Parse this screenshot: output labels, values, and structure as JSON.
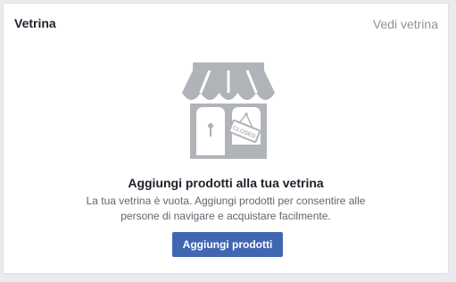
{
  "card": {
    "title": "Vetrina",
    "see_link": "Vedi vetrina"
  },
  "empty_state": {
    "icon": "storefront-closed-icon",
    "sign_text": "CLOSED",
    "title": "Aggiungi prodotti alla tua vetrina",
    "description_line1": "La tua vetrina è vuota. Aggiungi prodotti per consentire alle",
    "description_line2": "persone di navigare e acquistare facilmente.",
    "button_label": "Aggiungi prodotti"
  },
  "colors": {
    "accent": "#4267b2",
    "icon_gray": "#b0b3b8",
    "title_text": "#1d2129",
    "muted_text": "#90949c"
  }
}
